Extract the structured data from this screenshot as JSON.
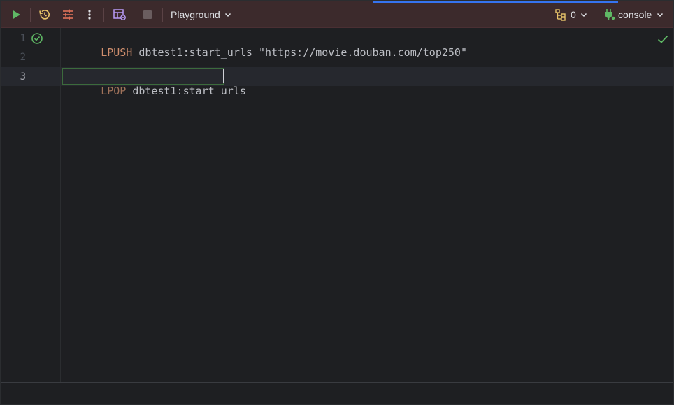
{
  "toolbar": {
    "run_icon": "play-icon",
    "history_icon": "history-icon",
    "settings_icon": "tune-icon",
    "more_icon": "vertical-dots-icon",
    "data_view_icon": "table-view-icon",
    "stop_icon": "stop-icon",
    "mode_label": "Playground",
    "tx_count": "0",
    "session_label": "console"
  },
  "editor": {
    "lines": [
      {
        "number": "1",
        "keyword": "LPUSH",
        "rest": " dbtest1:start_urls \"https://movie.douban.com/top250\"",
        "status": "check-circle-icon"
      },
      {
        "number": "2",
        "keyword": "",
        "rest": ""
      },
      {
        "number": "3",
        "keyword": "LPOP",
        "rest": " dbtest1:start_urls"
      }
    ],
    "inspection_status": "checkmark-icon"
  },
  "colors": {
    "toolbar_bg": "#3c2a2c",
    "accent": "#3574f0",
    "keyword": "#cf8e6d",
    "success": "#5fb865"
  }
}
